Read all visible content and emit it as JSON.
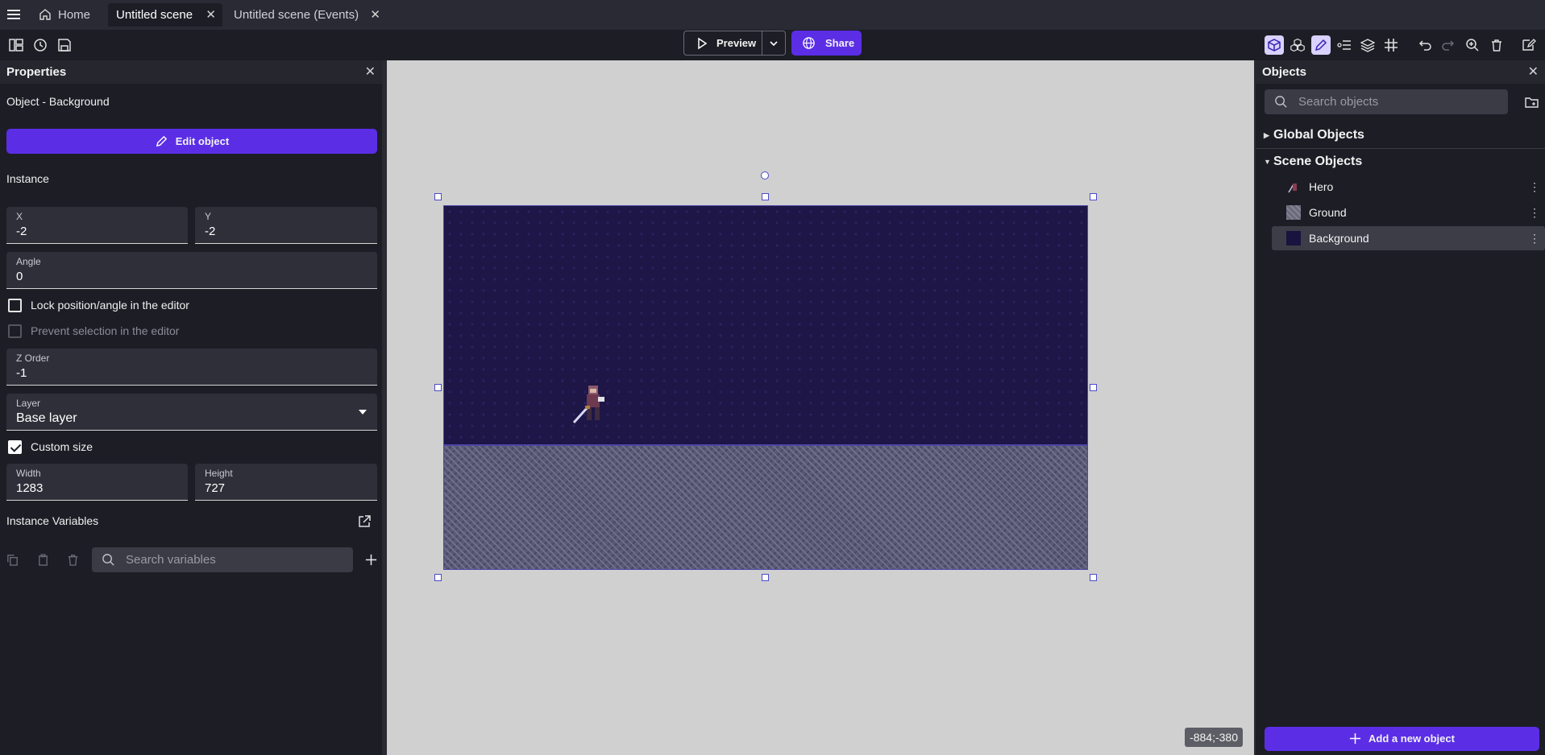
{
  "tabs": [
    {
      "label": "Home"
    },
    {
      "label": "Untitled scene"
    },
    {
      "label": "Untitled scene (Events)"
    }
  ],
  "toolbar": {
    "preview_label": "Preview",
    "share_label": "Share"
  },
  "properties": {
    "title": "Properties",
    "object_label": "Object  - Background",
    "edit_button": "Edit object",
    "instance_heading": "Instance",
    "x": {
      "label": "X",
      "value": "-2"
    },
    "y": {
      "label": "Y",
      "value": "-2"
    },
    "angle": {
      "label": "Angle",
      "value": "0"
    },
    "lock_label": "Lock position/angle in the editor",
    "prevent_label": "Prevent selection in the editor",
    "z_order": {
      "label": "Z Order",
      "value": "-1"
    },
    "layer": {
      "label": "Layer",
      "value": "Base layer"
    },
    "custom_size_label": "Custom size",
    "width": {
      "label": "Width",
      "value": "1283"
    },
    "height": {
      "label": "Height",
      "value": "727"
    },
    "variables_heading": "Instance Variables",
    "variables_search_placeholder": "Search variables"
  },
  "canvas": {
    "coordinates": "-884;-380"
  },
  "objects": {
    "title": "Objects",
    "search_placeholder": "Search objects",
    "global_group": "Global Objects",
    "scene_group": "Scene Objects",
    "items": [
      {
        "label": "Hero"
      },
      {
        "label": "Ground"
      },
      {
        "label": "Background"
      }
    ],
    "add_button": "Add a new object"
  },
  "colors": {
    "accent": "#5b2ee6",
    "background_panel": "#1d1d26",
    "canvas": "#d0d0d0"
  }
}
